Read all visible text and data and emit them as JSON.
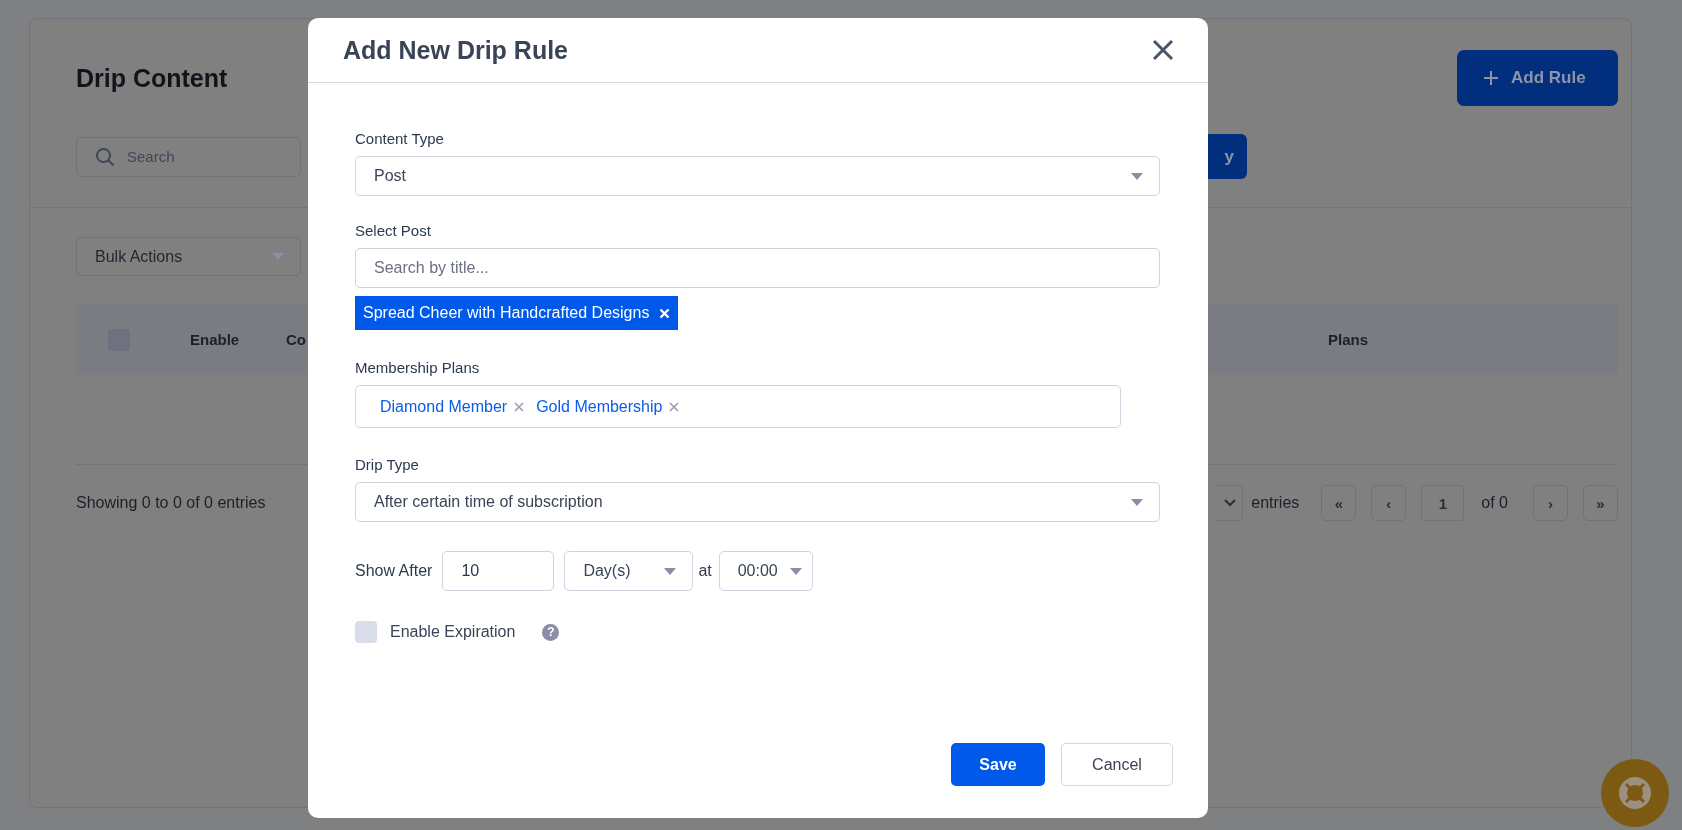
{
  "page": {
    "title": "Drip Content",
    "add_rule_button": {
      "label": "Add Rule"
    },
    "search": {
      "placeholder": "Search"
    },
    "partial_button": {
      "label": "y"
    },
    "bulk_actions": {
      "value": "Bulk Actions"
    },
    "table": {
      "select_all": {
        "checked": false
      },
      "columns": [
        "Enable",
        "Co",
        "Plans"
      ]
    },
    "footer": {
      "summary": "Showing 0 to 0 of 0 entries",
      "entries_label": "entries",
      "pagination": {
        "first": "«",
        "previous": "‹",
        "page": "1",
        "of": "of 0",
        "next": "›",
        "last": "»"
      }
    }
  },
  "modal": {
    "title": "Add New Drip Rule",
    "content_type": {
      "label": "Content Type",
      "value": "Post"
    },
    "select_post": {
      "label": "Select Post",
      "placeholder": "Search by title...",
      "selected": [
        {
          "label": "Spread Cheer with Handcrafted Designs"
        }
      ]
    },
    "membership_plans": {
      "label": "Membership Plans",
      "selected": [
        {
          "label": "Diamond Member"
        },
        {
          "label": "Gold Membership"
        }
      ]
    },
    "drip_type": {
      "label": "Drip Type",
      "value": "After certain time of subscription"
    },
    "show_after": {
      "label": "Show After",
      "value": "10",
      "unit": "Day(s)",
      "at_label": "at",
      "time": "00:00"
    },
    "enable_expiration": {
      "label": "Enable Expiration",
      "checked": false,
      "help": "?"
    },
    "buttons": [
      {
        "kind": "primary",
        "label": "Save"
      },
      {
        "kind": "secondary",
        "label": "Cancel"
      }
    ]
  }
}
